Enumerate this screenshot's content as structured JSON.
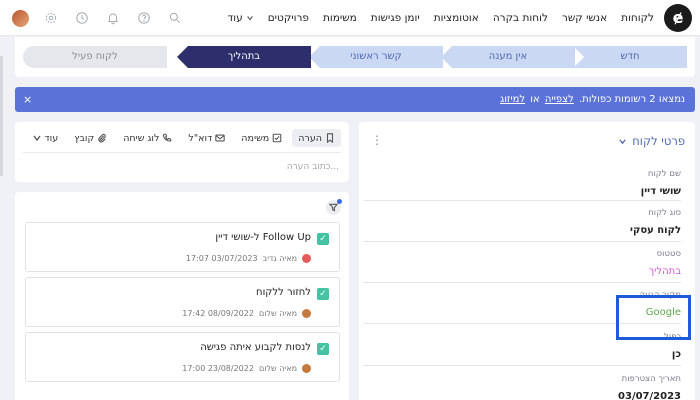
{
  "nav": {
    "logo": "ɇ",
    "links": [
      "לקוחות",
      "אנשי קשר",
      "לוחות בקרה",
      "אוטומציות",
      "יומן פגישות",
      "משימות",
      "פרויקטים"
    ],
    "more": "עוד"
  },
  "stages": {
    "new": "חדש",
    "no_answer": "אין מענה",
    "first_contact": "קשר ראשוני",
    "in_progress": "בתהליך",
    "active_client": "לקוח פעיל"
  },
  "banner": {
    "prefix": "נמצאו 2 רשומות כפולות.",
    "view_link": "לצפייה",
    "or": "או",
    "merge_link": "למיזוג",
    "close": "×"
  },
  "details": {
    "title": "פרטי לקוח",
    "fields": [
      {
        "label": "שם לקוח",
        "value": "שושי דיין"
      },
      {
        "label": "סוג לקוח",
        "value": "לקוח עסקי"
      },
      {
        "label": "סטטוס",
        "value": "בתהליך"
      },
      {
        "label": "מקור הגעה",
        "value": "Google"
      },
      {
        "label": "כפול",
        "value": "כן"
      },
      {
        "label": "תאריך הצטרפות",
        "value": "03/07/2023"
      }
    ]
  },
  "activity": {
    "tabs": [
      "הערה",
      "משימה",
      "דוא\"ל",
      "לוג שיחה",
      "קובץ",
      "עוד"
    ],
    "note_placeholder": "כתוב הערה..."
  },
  "tasks": [
    {
      "title": "Follow Up ל-שושי דיין",
      "user": "מאיה גדיב",
      "time": "17:07 03/07/2023",
      "avatar": "red"
    },
    {
      "title": "לחזור ללקוח",
      "user": "מאיה שלום",
      "time": "17:42 08/09/2022",
      "avatar": "brown"
    },
    {
      "title": "לנסות לקבוע איתה פגישה",
      "user": "מאיה שלום",
      "time": "17:00 23/08/2022",
      "avatar": "brown"
    }
  ],
  "colors": {
    "accent": "#5b73d8",
    "stage_active": "#2e2e6c",
    "check": "#43c3a3",
    "highlight": "#1e5bd8"
  }
}
